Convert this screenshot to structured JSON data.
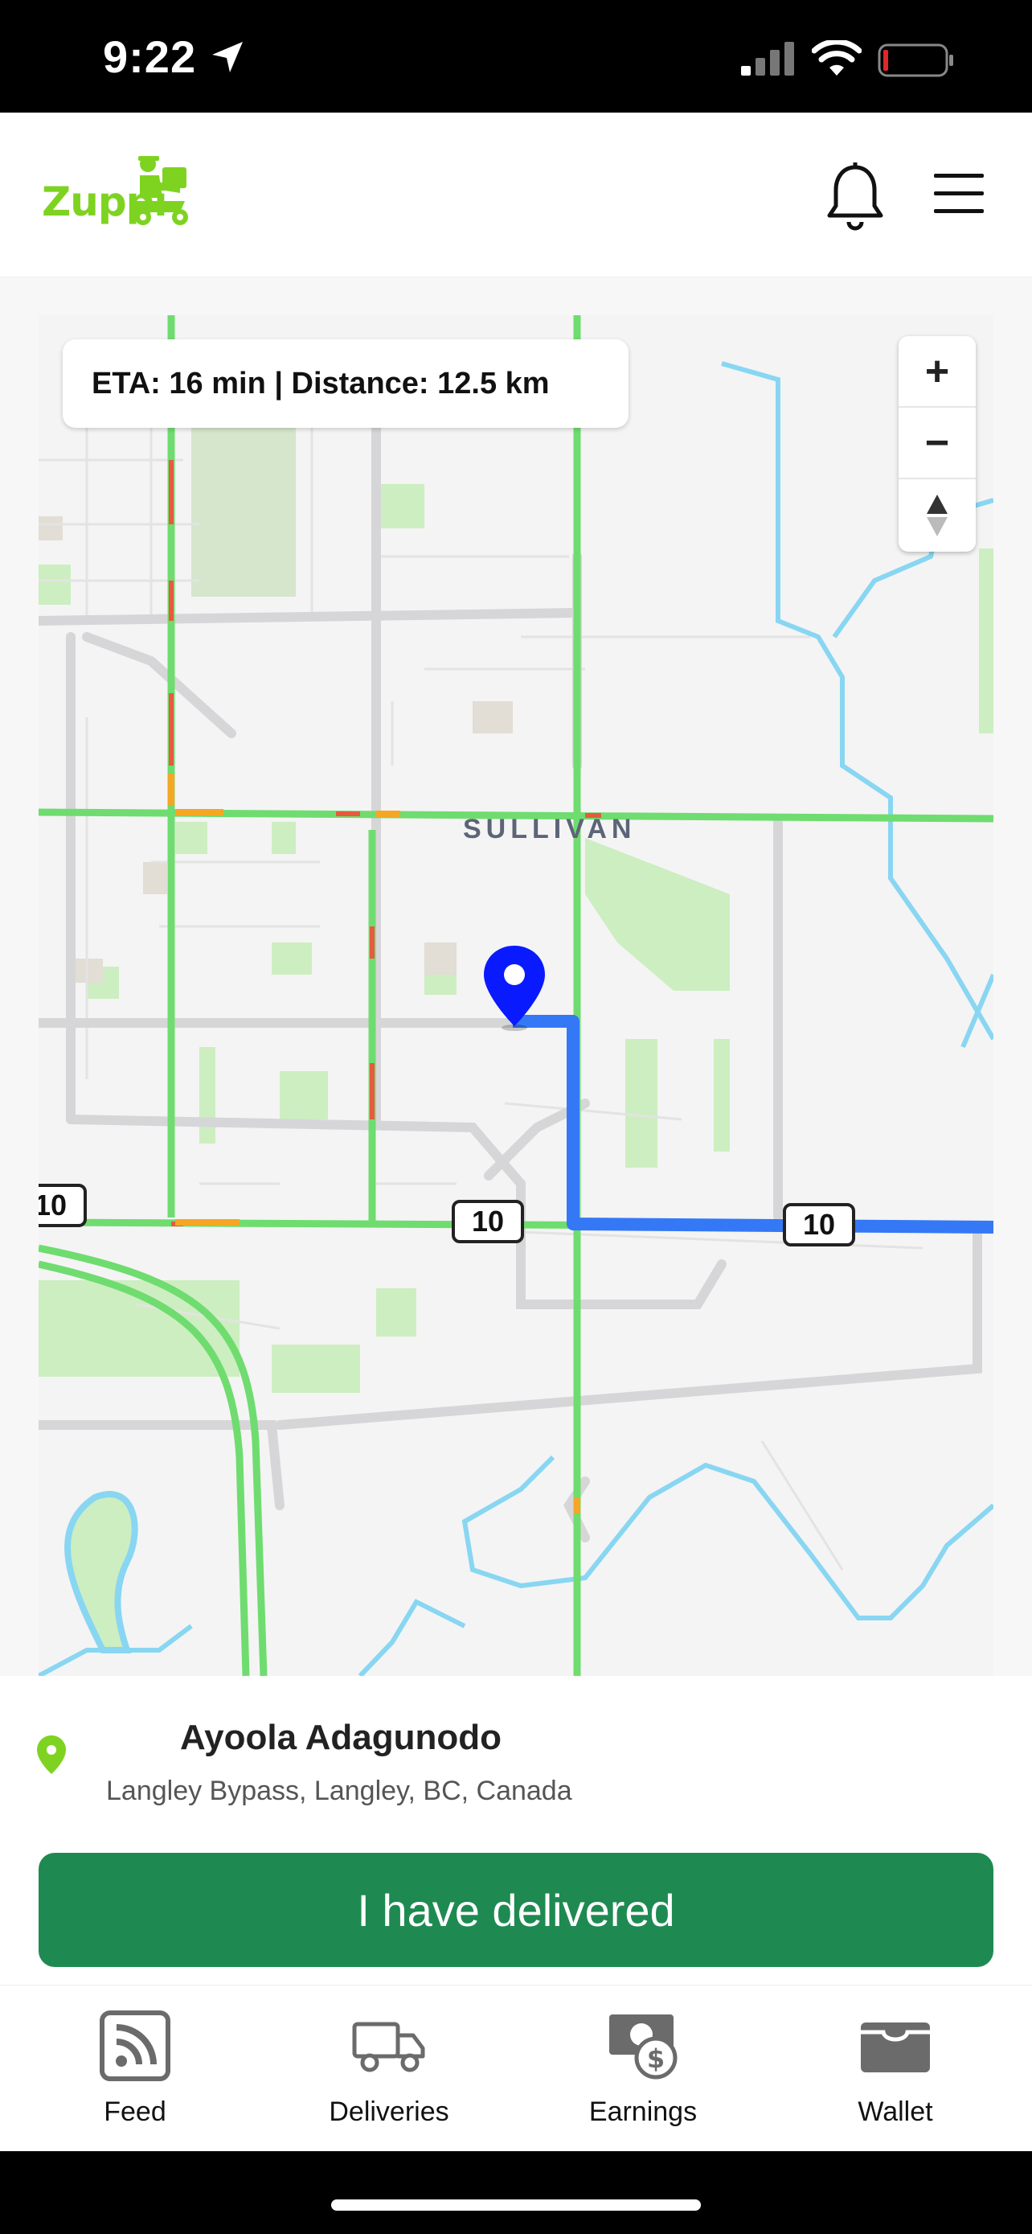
{
  "status_bar": {
    "time": "9:22",
    "icons": [
      "location-arrow-icon",
      "cellular-signal-icon",
      "wifi-icon",
      "battery-low-icon"
    ]
  },
  "header": {
    "logo_text": "Zuppi",
    "icons": [
      "bell-icon",
      "hamburger-menu-icon"
    ]
  },
  "map": {
    "eta_text": "ETA: 16 min | Distance: 12.5 km",
    "zoom_in": "+",
    "zoom_out": "−",
    "compass": "▲",
    "area_label": "SULLIVAN",
    "highway_shields": [
      "10",
      "10",
      "10"
    ],
    "route_color": "#3478f6",
    "pin_color": "#0a1aff"
  },
  "delivery": {
    "recipient_name": "Ayoola Adagunodo",
    "address": "Langley Bypass, Langley, BC, Canada",
    "button_label": "I have delivered"
  },
  "tabs": [
    {
      "label": "Feed",
      "icon": "rss-feed-icon"
    },
    {
      "label": "Deliveries",
      "icon": "truck-icon"
    },
    {
      "label": "Earnings",
      "icon": "money-icon"
    },
    {
      "label": "Wallet",
      "icon": "wallet-icon"
    }
  ],
  "colors": {
    "brand_green": "#7ed321",
    "action_green": "#1e8a52"
  }
}
